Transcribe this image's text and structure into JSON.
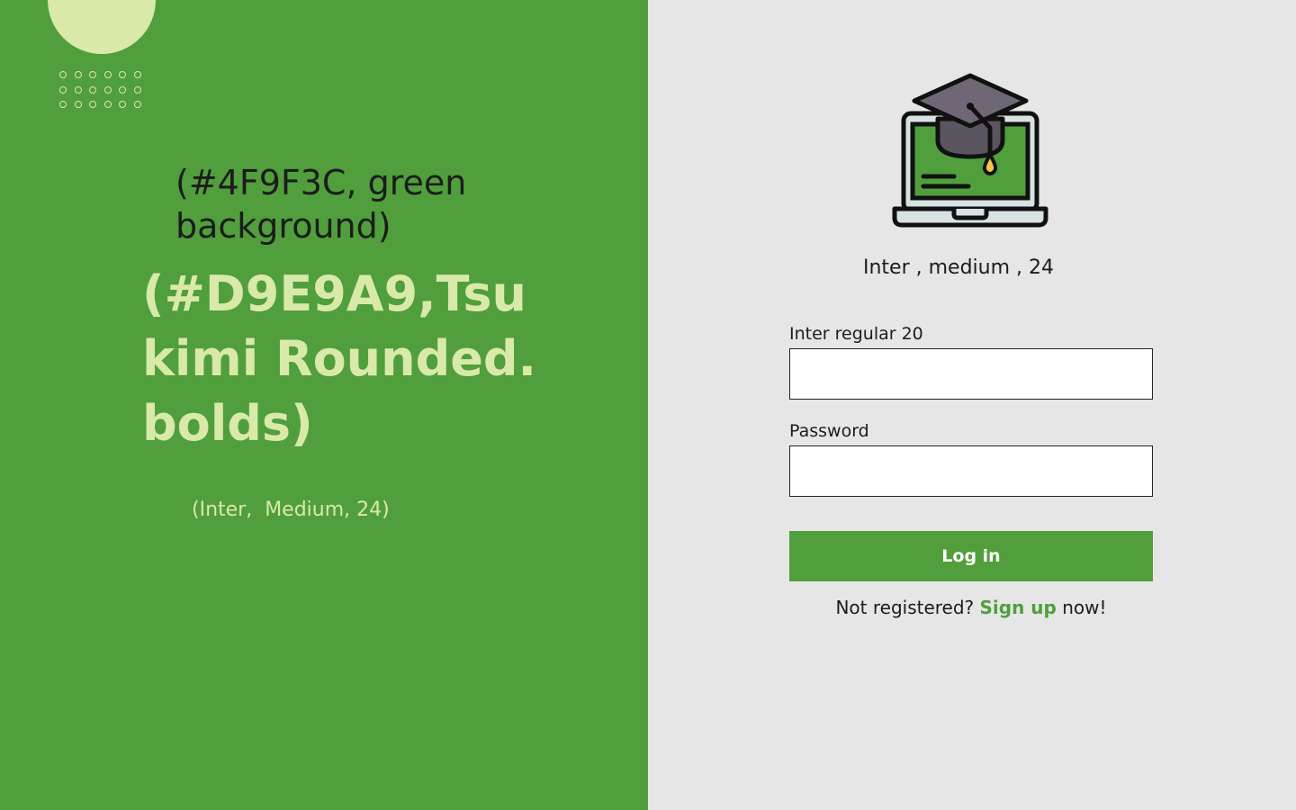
{
  "colors": {
    "green": "#519F3C",
    "light_green": "#D9E9A9",
    "panel_grey": "#E6E6E6",
    "text_dark": "#1C1C1C"
  },
  "left_panel": {
    "decor": {
      "circle_icon": "decorative-circle",
      "dots_icon": "dot-grid-pattern"
    },
    "note": "(#4F9F3C, green background)",
    "headline": "(#D9E9A9,Tsukimi Rounded.bolds)",
    "subtext": "(Inter,  Medium, 24)"
  },
  "right_panel": {
    "logo_icon": "graduation-cap-laptop-icon",
    "title": "Inter , medium , 24",
    "username_label": "Inter regular 20",
    "username_value": "",
    "password_label": "Password",
    "password_value": "",
    "login_button": "Log in",
    "signup": {
      "prefix": "Not registered?",
      "link": "Sign up",
      "suffix": "now!"
    }
  }
}
